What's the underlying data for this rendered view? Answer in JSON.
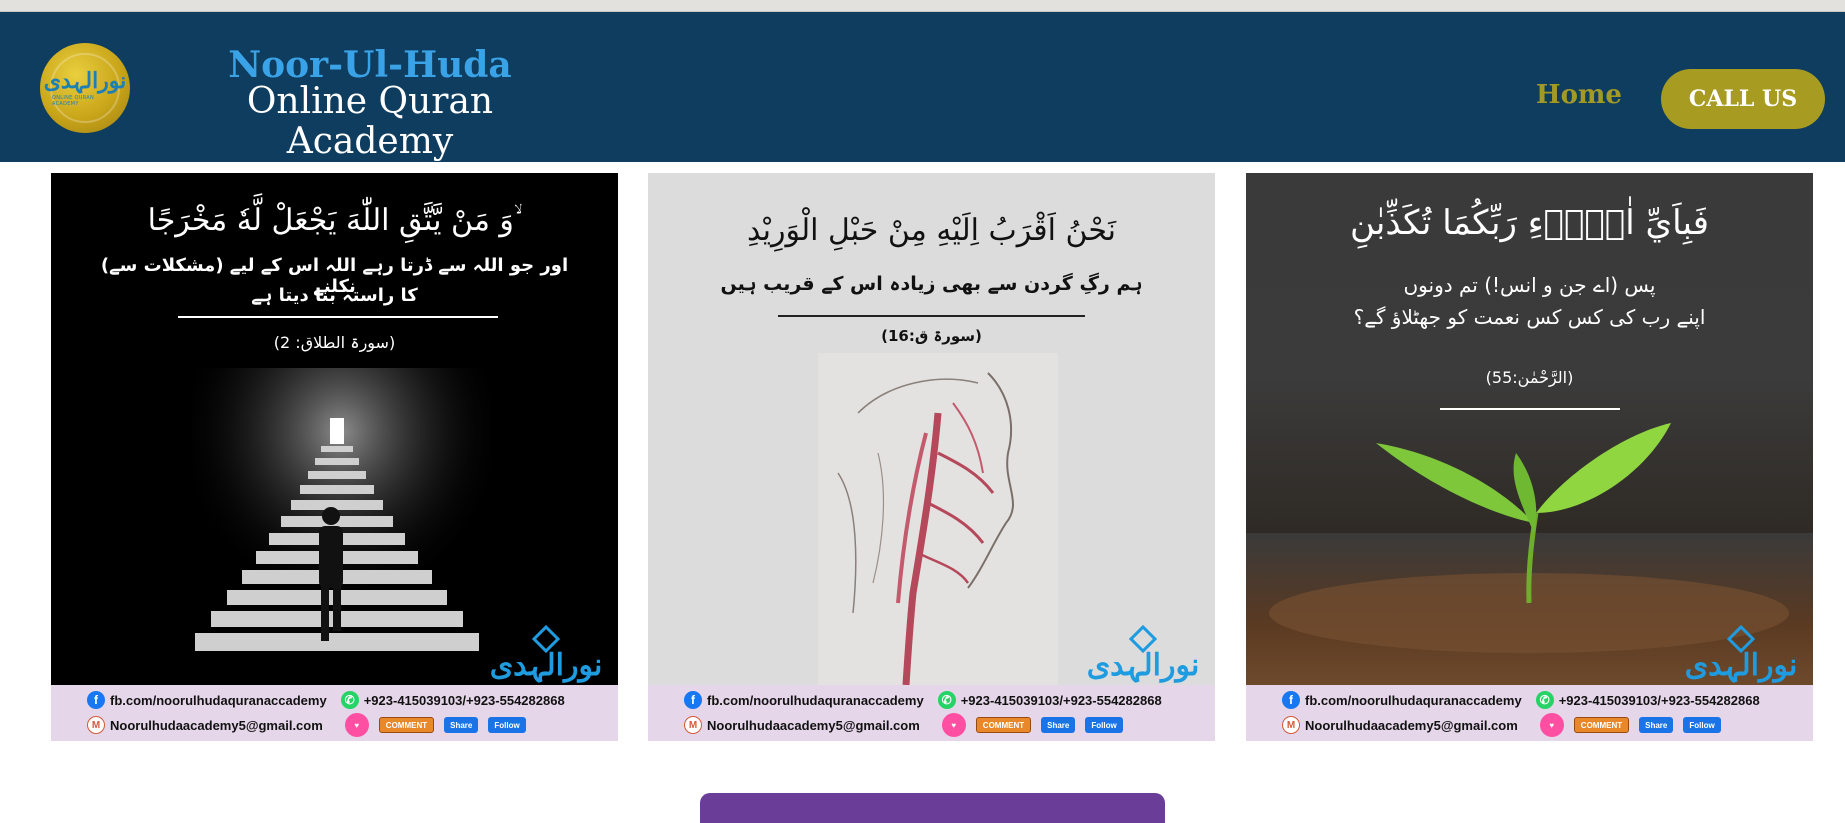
{
  "header": {
    "logo_alt": "نورالہدی",
    "logo_sub": "ONLINE QURAN ACADEMY",
    "brand_line1": "Noor-Ul-Huda",
    "brand_line2": "Online Quran Academy",
    "nav_home": "Home",
    "call_button": "CALL US"
  },
  "cards": [
    {
      "ayah": "وَ مَنْ يَّتَّقِ اللّٰهَ يَجْعَلْ لَّهٗ مَخْرَجًا ۙ",
      "urdu_line1": "اور جو اللہ سے ڈرتا رہے اللہ اس کے لیے (مشکلات سے) نکلنے",
      "urdu_line2": "کا راستہ بنا دیتا ہے",
      "reference": "(سورۃ الطلاق: 2)",
      "watermark": "نورالہدی",
      "footer_fb": "fb.com/noorulhudaquranaccademy",
      "footer_phone": "+923-415039103/+923-554282868",
      "footer_email": "Noorulhudaacademy5@gmail.com",
      "share": "Share",
      "follow": "Follow",
      "comment": "COMMENT"
    },
    {
      "ayah": "نَحْنُ اَقْرَبُ اِلَيْهِ مِنْ حَبْلِ الْوَرِيْدِ",
      "urdu_line1": "ہم رگِ گردن سے بھی زیادہ اس کے قریب ہیں",
      "urdu_line2": "",
      "reference": "(سورۃ ق:16)",
      "watermark": "نورالہدی",
      "footer_fb": "fb.com/noorulhudaquranaccademy",
      "footer_phone": "+923-415039103/+923-554282868",
      "footer_email": "Noorulhudaacademy5@gmail.com",
      "share": "Share",
      "follow": "Follow",
      "comment": "COMMENT"
    },
    {
      "ayah": "فَبِاَيِّ اٰلَاۤءِ رَبِّكُمَا تُكَذِّبٰنِ",
      "urdu_line1": "پس (اے جن و انس!) تم دونوں",
      "urdu_line2": "اپنے رب کی کس کس نعمت کو جھٹلاؤ گے؟",
      "reference": "(الرَّحْمٰن:55)",
      "watermark": "نورالہدی",
      "footer_fb": "fb.com/noorulhudaquranaccademy",
      "footer_phone": "+923-415039103/+923-554282868",
      "footer_email": "Noorulhudaacademy5@gmail.com",
      "share": "Share",
      "follow": "Follow",
      "comment": "COMMENT"
    }
  ],
  "colors": {
    "header_bg": "#0f3d5f",
    "brand_accent": "#3aa2e6",
    "gold": "#a79b21",
    "footer_strip": "#e6d6ea"
  },
  "icons": [
    "facebook-icon",
    "whatsapp-icon",
    "gmail-icon",
    "like-icon"
  ]
}
